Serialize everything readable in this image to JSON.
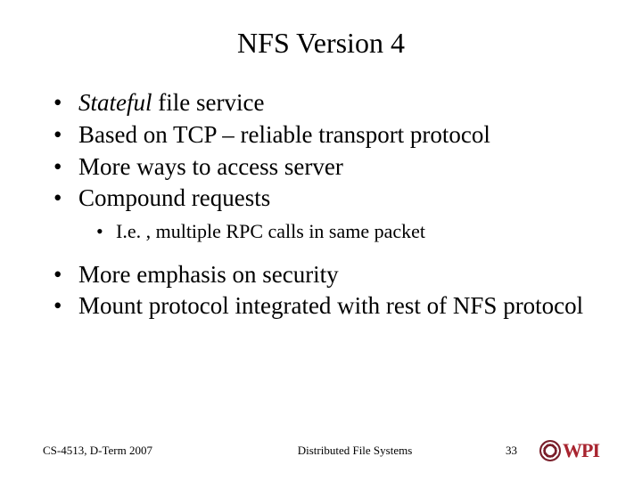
{
  "title": "NFS Version 4",
  "bullets1": [
    {
      "italic": "Stateful",
      "rest": " file service"
    },
    {
      "text": "Based on TCP – reliable transport protocol"
    },
    {
      "text": "More ways to access server"
    },
    {
      "text": "Compound requests"
    }
  ],
  "sub1": "I.e. , multiple RPC calls in same packet",
  "bullets2": [
    {
      "text": "More emphasis on security"
    },
    {
      "text": "Mount protocol integrated with rest of NFS protocol"
    }
  ],
  "footer": {
    "left": "CS-4513, D-Term 2007",
    "center": "Distributed File Systems",
    "page": "33",
    "logo_text": "WPI"
  }
}
